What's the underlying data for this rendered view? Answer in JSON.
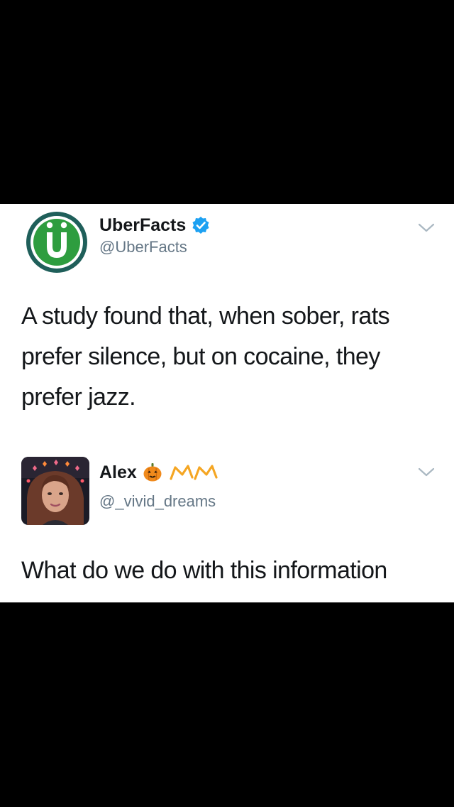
{
  "tweets": [
    {
      "display_name": "UberFacts",
      "handle": "@UberFacts",
      "verified": true,
      "avatar_icon": "uberfacts-logo",
      "text": "A study found that, when sober, rats prefer silence, but on cocaine, they prefer jazz."
    },
    {
      "display_name": "Alex",
      "handle": "@_vivid_dreams",
      "verified": false,
      "avatar_icon": "profile-photo",
      "name_emojis": [
        "jack-o-lantern-icon",
        "crown-icon",
        "crown-icon"
      ],
      "text": "What do we do with this information"
    }
  ],
  "colors": {
    "background": "#000000",
    "card": "#ffffff",
    "text": "#14171a",
    "handle": "#657786",
    "verified_blue": "#1da1f2",
    "uber_green": "#2e9d3f"
  }
}
